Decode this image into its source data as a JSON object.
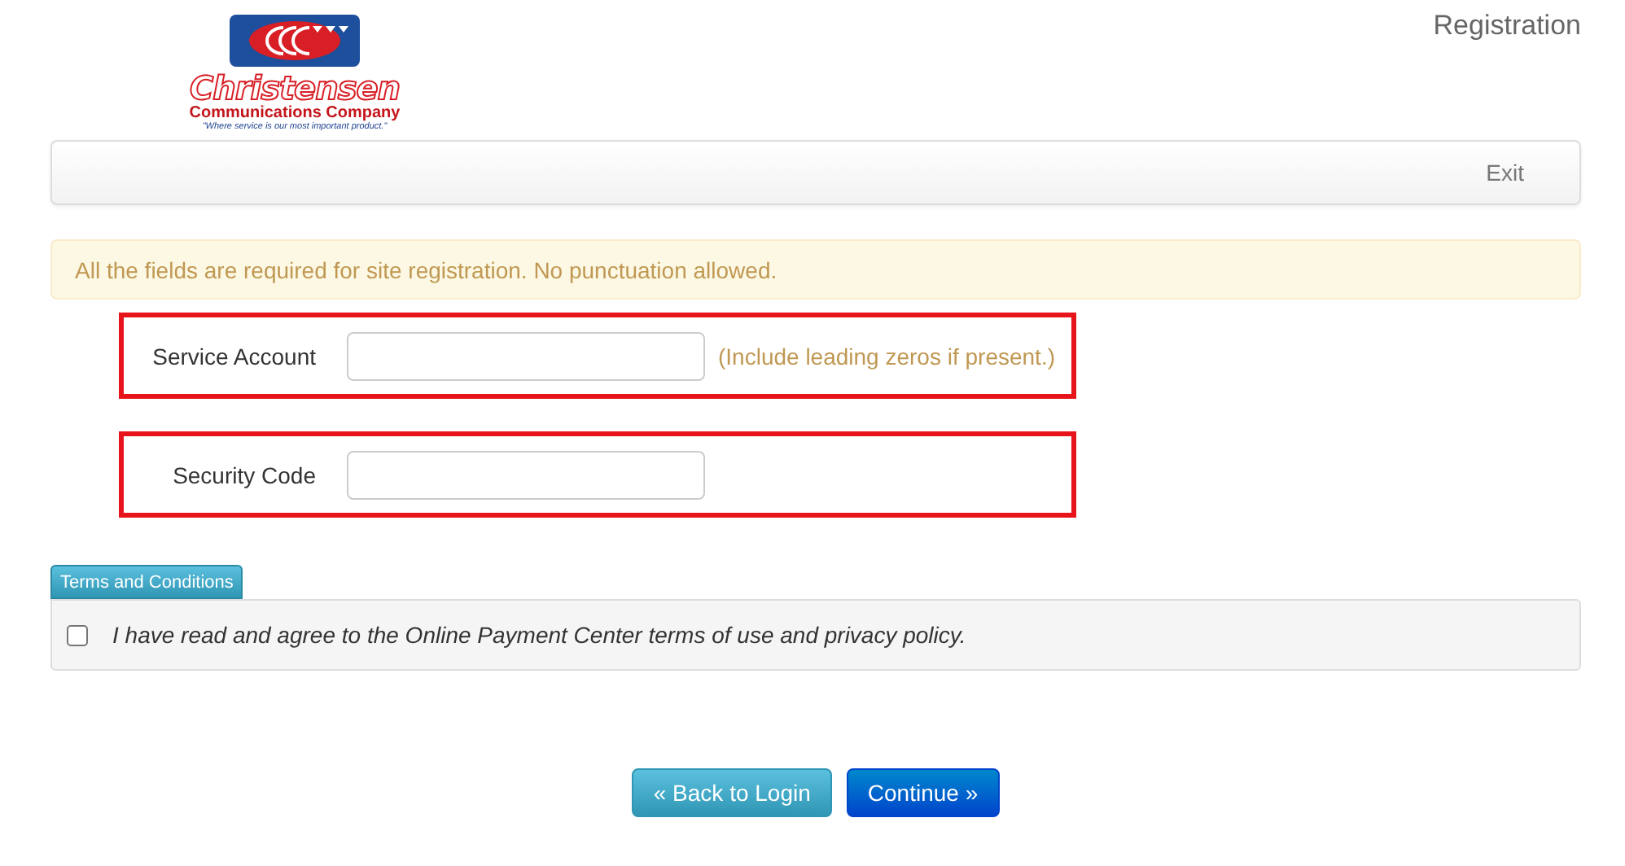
{
  "logo": {
    "name": "Christensen",
    "subtitle": "Communications Company",
    "tagline": "\"Where service is our most important product.\""
  },
  "page_title": "Registration",
  "navbar": {
    "exit": "Exit"
  },
  "alert": "All the fields are required for site registration. No punctuation allowed.",
  "fields": [
    {
      "label": "Service Account",
      "hint": "(Include leading zeros if present.)",
      "highlighted": true
    },
    {
      "label": "Security Code",
      "highlighted": true
    }
  ],
  "terms": {
    "button": "Terms and Conditions",
    "agreement": "I have read and agree to the Online Payment Center terms of use and privacy policy.",
    "checked": false
  },
  "buttons": [
    {
      "label": "« Back to Login",
      "kind": "secondary"
    },
    {
      "label": "Continue »",
      "kind": "primary"
    }
  ]
}
